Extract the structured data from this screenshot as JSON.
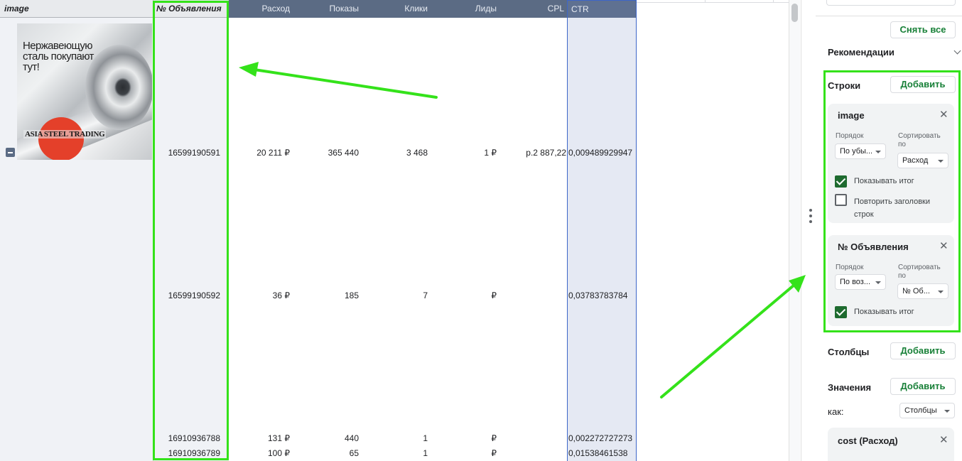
{
  "table": {
    "headers": {
      "image": "image",
      "ad_number": "№ Объявления",
      "cost": "Расход",
      "impressions": "Показы",
      "clicks": "Клики",
      "leads": "Лиды",
      "cpl": "CPL",
      "ctr": "CTR"
    },
    "ad_image": {
      "text": "Нержавеющую сталь покупают тут!",
      "logo_text": "ASIA STEEL TRADING"
    },
    "rows": [
      {
        "ad_number": "16599190591",
        "cost": "20 211 ₽",
        "impressions": "365 440",
        "clicks": "3 468",
        "leads": "1 ₽",
        "cpl": "р.2 887,22",
        "ctr": "0,009489929947"
      },
      {
        "ad_number": "16599190592",
        "cost": "36 ₽",
        "impressions": "185",
        "clicks": "7",
        "leads": "₽",
        "cpl": "",
        "ctr": "0,03783783784"
      },
      {
        "ad_number": "16910936788",
        "cost": "131 ₽",
        "impressions": "440",
        "clicks": "1",
        "leads": "₽",
        "cpl": "",
        "ctr": "0,002272727273"
      },
      {
        "ad_number": "16910936789",
        "cost": "100 ₽",
        "impressions": "65",
        "clicks": "1",
        "leads": "₽",
        "cpl": "",
        "ctr": "0,01538461538"
      }
    ]
  },
  "panel": {
    "clear_all": "Снять все",
    "recommendations": "Рекомендации",
    "rows_label": "Строки",
    "add": "Добавить",
    "row_group_1": {
      "title": "image",
      "order_label": "Порядок",
      "order_value": "По убы...",
      "sort_label": "Сортировать по",
      "sort_value": "Расход",
      "show_total": "Показывать итог",
      "show_total_checked": true,
      "repeat_headers": "Повторить заголовки строк",
      "repeat_headers_checked": false
    },
    "row_group_2": {
      "title": "№ Объявления",
      "order_label": "Порядок",
      "order_value": "По воз...",
      "sort_label": "Сортировать по",
      "sort_value": "№ Об...",
      "show_total": "Показывать итог",
      "show_total_checked": true
    },
    "columns_label": "Столбцы",
    "values_label": "Значения",
    "as_label": "как:",
    "as_value": "Столбцы",
    "value_card_title": "cost (Расход)"
  },
  "colors": {
    "highlight": "#34e21a",
    "header_dark": "#5b6b84",
    "selection_blue": "#3d66c8",
    "accent_green": "#188038"
  }
}
